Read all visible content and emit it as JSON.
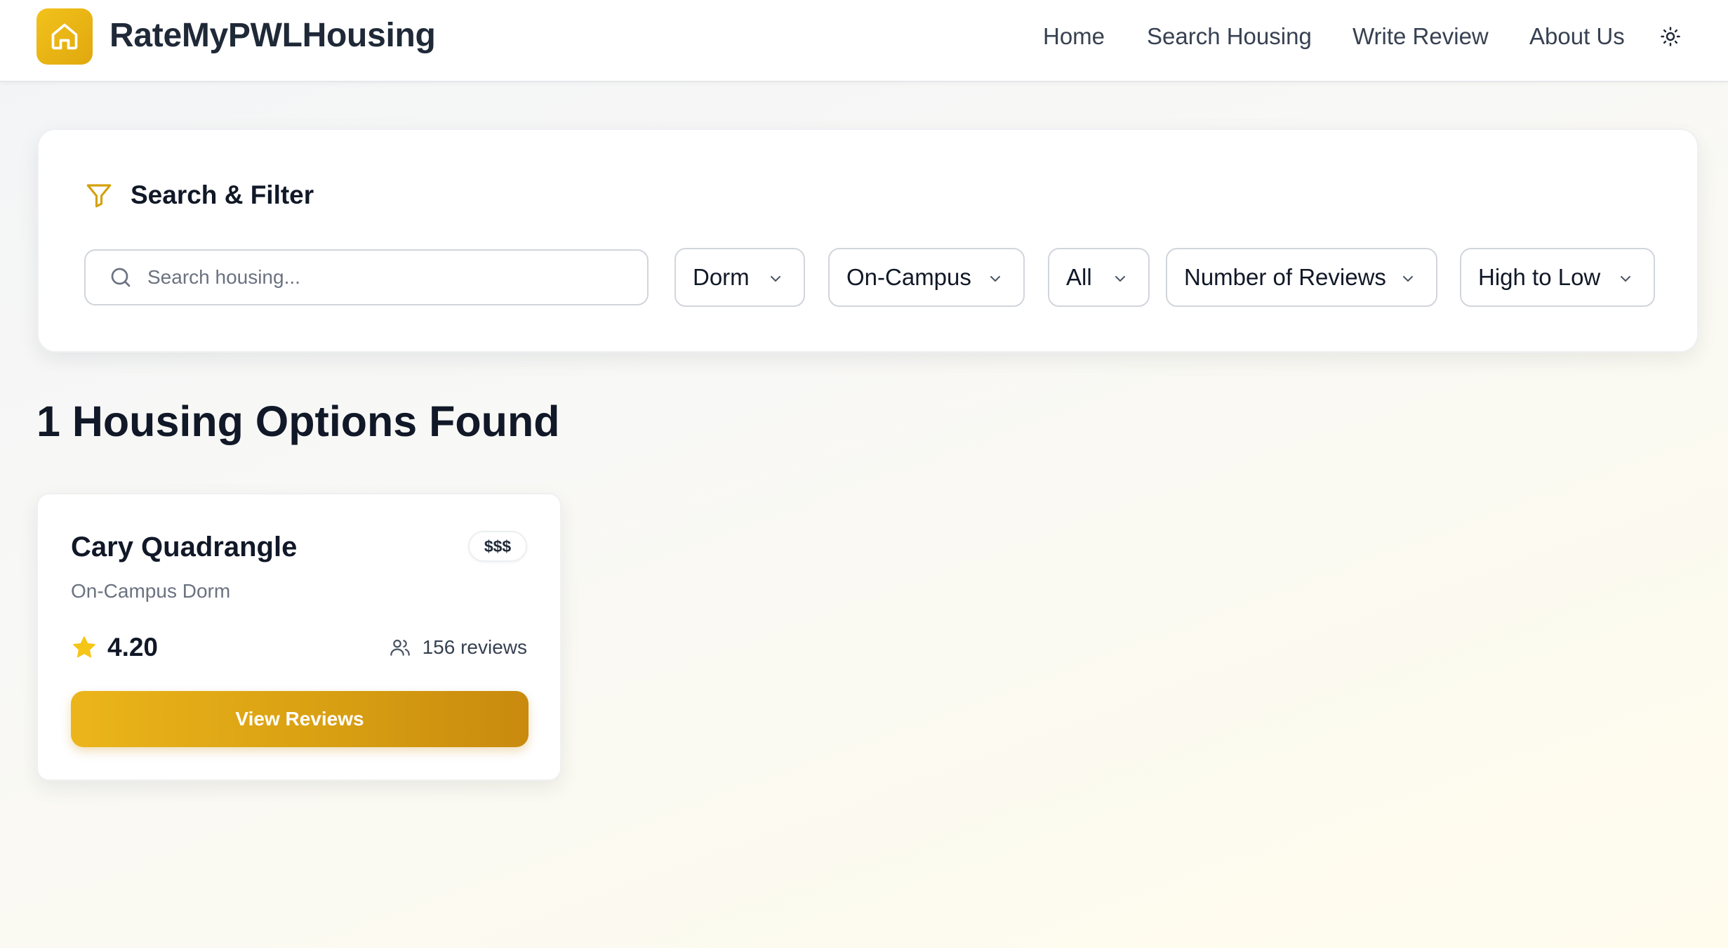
{
  "header": {
    "brand": "RateMyPWLHousing",
    "logo_icon": "home-icon",
    "nav": [
      {
        "label": "Home"
      },
      {
        "label": "Search Housing"
      },
      {
        "label": "Write Review"
      },
      {
        "label": "About Us"
      }
    ],
    "theme_icon": "sun-icon"
  },
  "filters": {
    "title": "Search & Filter",
    "title_icon": "filter-icon",
    "search": {
      "placeholder": "Search housing...",
      "value": ""
    },
    "housing_type": {
      "value": "Dorm"
    },
    "location": {
      "value": "On-Campus"
    },
    "price": {
      "value": "All"
    },
    "sort_by": {
      "value": "Number of Reviews"
    },
    "sort_order": {
      "value": "High to Low"
    }
  },
  "results": {
    "heading": "1 Housing Options Found",
    "items": [
      {
        "name": "Cary Quadrangle",
        "price": "$$$",
        "subtitle": "On-Campus Dorm",
        "rating": "4.20",
        "reviews": "156 reviews",
        "button": "View Reviews"
      }
    ]
  },
  "colors": {
    "accent": "#e0a80e",
    "accent_light": "#f2c21b",
    "star": "#f5c518",
    "text_dark": "#111827",
    "text_muted": "#6b7280"
  }
}
